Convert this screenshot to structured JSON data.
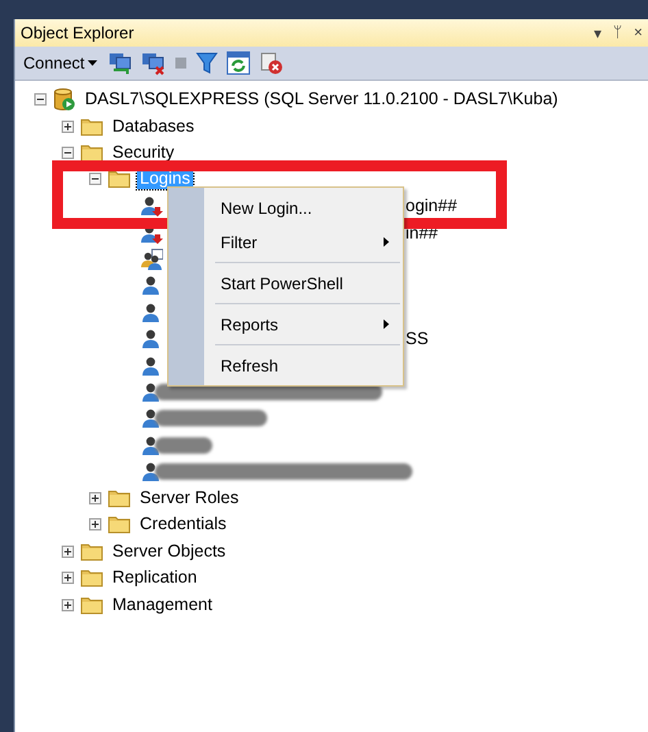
{
  "panel": {
    "title": "Object Explorer",
    "buttons": [
      "▾",
      "ᛘ",
      "×"
    ]
  },
  "toolbar": {
    "connect": "Connect",
    "tools": [
      {
        "kind": "connect-server"
      },
      {
        "kind": "disconnect"
      },
      {
        "kind": "stop"
      },
      {
        "kind": "filter"
      },
      {
        "kind": "refresh"
      },
      {
        "kind": "script-stop"
      }
    ]
  },
  "tree": {
    "label": "DASL7\\SQLEXPRESS (SQL Server 11.0.2100 - DASL7\\Kuba)",
    "kind": "server",
    "expanded": true,
    "selected": false,
    "children": [
      {
        "label": "Databases",
        "kind": "folder",
        "expanded": false,
        "selected": false
      },
      {
        "label": "Security",
        "kind": "folder",
        "expanded": true,
        "selected": false,
        "children": [
          {
            "label": "Logins",
            "kind": "folder",
            "expanded": true,
            "selected": true,
            "children": [
              {
                "kind": "login-alert",
                "label": "ogin##"
              },
              {
                "kind": "login-alert",
                "label": "in##"
              },
              {
                "kind": "group"
              },
              {
                "kind": "login"
              },
              {
                "kind": "login"
              },
              {
                "kind": "login",
                "label": "SS"
              },
              {
                "kind": "login"
              },
              {
                "kind": "redacted"
              },
              {
                "kind": "redacted"
              },
              {
                "kind": "redacted"
              },
              {
                "kind": "redacted"
              }
            ]
          },
          {
            "label": "Server Roles",
            "kind": "folder",
            "expanded": false,
            "selected": false
          },
          {
            "label": "Credentials",
            "kind": "folder",
            "expanded": false,
            "selected": false
          }
        ]
      },
      {
        "label": "Server Objects",
        "kind": "folder",
        "expanded": false,
        "selected": false
      },
      {
        "label": "Replication",
        "kind": "folder",
        "expanded": false,
        "selected": false
      },
      {
        "label": "Management",
        "kind": "folder",
        "expanded": false,
        "selected": false
      }
    ]
  },
  "context_menu": {
    "items": [
      {
        "kind": "item",
        "label": "New Login...",
        "submenu": false
      },
      {
        "kind": "item",
        "label": "Filter",
        "submenu": true
      },
      {
        "kind": "separator"
      },
      {
        "kind": "item",
        "label": "Start PowerShell",
        "submenu": false
      },
      {
        "kind": "separator"
      },
      {
        "kind": "item",
        "label": "Reports",
        "submenu": true
      },
      {
        "kind": "separator"
      },
      {
        "kind": "item",
        "label": "Refresh",
        "submenu": false
      }
    ]
  },
  "highlight": {
    "kind": "frame",
    "color": "#ed1c24"
  }
}
